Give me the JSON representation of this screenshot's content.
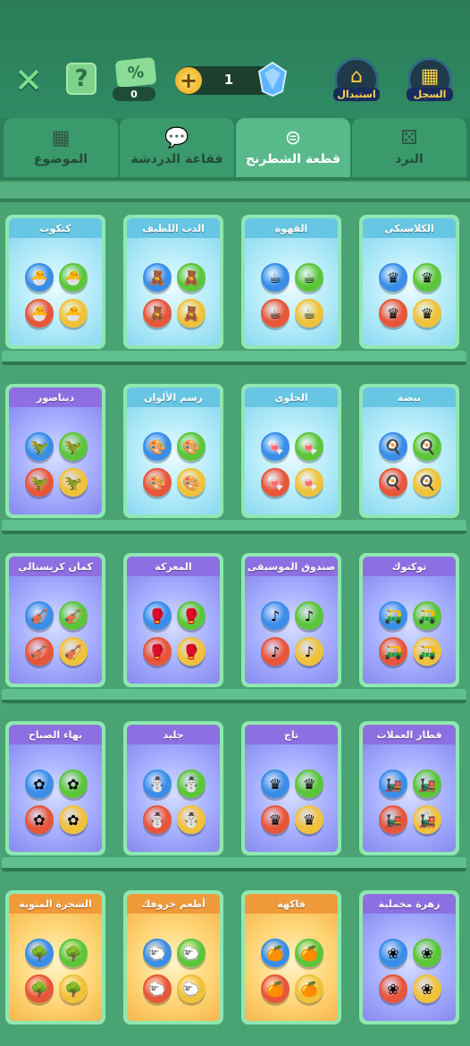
{
  "header": {
    "close_icon": "close-icon",
    "help_label": "?",
    "coupon_label": "%",
    "coupon_count": "0",
    "gem_count": "1",
    "exchange_label": "استبدال",
    "history_label": "السجل"
  },
  "tabs": [
    {
      "label": "الموضوع",
      "icon": "grid-icon"
    },
    {
      "label": "فقاعة الدردشة",
      "icon": "chat-icon"
    },
    {
      "label": "قطعة الشطرنج",
      "icon": "piece-icon"
    },
    {
      "label": "النرد",
      "icon": "dice-icon"
    }
  ],
  "active_tab": "قطعة الشطرنج",
  "rows": [
    [
      {
        "title": "الكلاسيكي",
        "theme": "blue",
        "colors": [
          "#3a8ee8",
          "#5cc63a",
          "#e8563a",
          "#f0c23a"
        ],
        "glyph": "♛"
      },
      {
        "title": "القهوة",
        "theme": "blue",
        "colors": [
          "#3a8ee8",
          "#5cc63a",
          "#e8563a",
          "#f0c23a"
        ],
        "glyph": "☕"
      },
      {
        "title": "الدب اللطيف",
        "theme": "blue",
        "colors": [
          "#3a8ee8",
          "#5cc63a",
          "#e8563a",
          "#f0c23a"
        ],
        "glyph": "🧸"
      },
      {
        "title": "كتكوت",
        "theme": "blue",
        "colors": [
          "#3a8ee8",
          "#5cc63a",
          "#e8563a",
          "#f0c23a"
        ],
        "glyph": "🐣"
      }
    ],
    [
      {
        "title": "بيضة",
        "theme": "blue",
        "colors": [
          "#3a8ee8",
          "#5cc63a",
          "#e8563a",
          "#f0c23a"
        ],
        "glyph": "🍳"
      },
      {
        "title": "الحلوى",
        "theme": "blue",
        "colors": [
          "#3a8ee8",
          "#5cc63a",
          "#e8563a",
          "#f0c23a"
        ],
        "glyph": "🍬"
      },
      {
        "title": "رسم الألوان",
        "theme": "blue",
        "colors": [
          "#3a8ee8",
          "#5cc63a",
          "#e8563a",
          "#f0c23a"
        ],
        "glyph": "🎨"
      },
      {
        "title": "ديناصور",
        "theme": "purple",
        "colors": [
          "#3a8ee8",
          "#5cc63a",
          "#e8563a",
          "#f0c23a"
        ],
        "glyph": "🦖"
      }
    ],
    [
      {
        "title": "توكتوك",
        "theme": "purple",
        "colors": [
          "#3a8ee8",
          "#5cc63a",
          "#e8563a",
          "#f0c23a"
        ],
        "glyph": "🛺"
      },
      {
        "title": "صندوق الموسيقى",
        "theme": "purple",
        "colors": [
          "#3a8ee8",
          "#5cc63a",
          "#e8563a",
          "#f0c23a"
        ],
        "glyph": "♪"
      },
      {
        "title": "المعركة",
        "theme": "purple",
        "colors": [
          "#3a8ee8",
          "#5cc63a",
          "#e8563a",
          "#f0c23a"
        ],
        "glyph": "🥊"
      },
      {
        "title": "كمان كريستالي",
        "theme": "purple",
        "colors": [
          "#3a8ee8",
          "#5cc63a",
          "#e8563a",
          "#f0c23a"
        ],
        "glyph": "🎻"
      }
    ],
    [
      {
        "title": "قطار العملات",
        "theme": "purple",
        "colors": [
          "#3a8ee8",
          "#5cc63a",
          "#e8563a",
          "#f0c23a"
        ],
        "glyph": "🚂"
      },
      {
        "title": "تاج",
        "theme": "purple",
        "colors": [
          "#3a8ee8",
          "#5cc63a",
          "#e8563a",
          "#f0c23a"
        ],
        "glyph": "♛"
      },
      {
        "title": "جليد",
        "theme": "purple",
        "colors": [
          "#3a8ee8",
          "#5cc63a",
          "#e8563a",
          "#f0c23a"
        ],
        "glyph": "⛄"
      },
      {
        "title": "بهاء الصباح",
        "theme": "purple",
        "colors": [
          "#3a8ee8",
          "#5cc63a",
          "#e8563a",
          "#f0c23a"
        ],
        "glyph": "✿"
      }
    ],
    [
      {
        "title": "زهرة مخملية",
        "theme": "purple",
        "colors": [
          "#3a8ee8",
          "#5cc63a",
          "#e8563a",
          "#f0c23a"
        ],
        "glyph": "❀"
      },
      {
        "title": "فاكهة",
        "theme": "orange",
        "colors": [
          "#3a8ee8",
          "#5cc63a",
          "#e8563a",
          "#f0c23a"
        ],
        "glyph": "🍊"
      },
      {
        "title": "أطعم خروفك",
        "theme": "orange",
        "colors": [
          "#3a8ee8",
          "#5cc63a",
          "#e8563a",
          "#f0c23a"
        ],
        "glyph": "🐑"
      },
      {
        "title": "الشجرة المتوية",
        "theme": "orange",
        "colors": [
          "#3a8ee8",
          "#5cc63a",
          "#e8563a",
          "#f0c23a"
        ],
        "glyph": "🌳"
      }
    ]
  ]
}
